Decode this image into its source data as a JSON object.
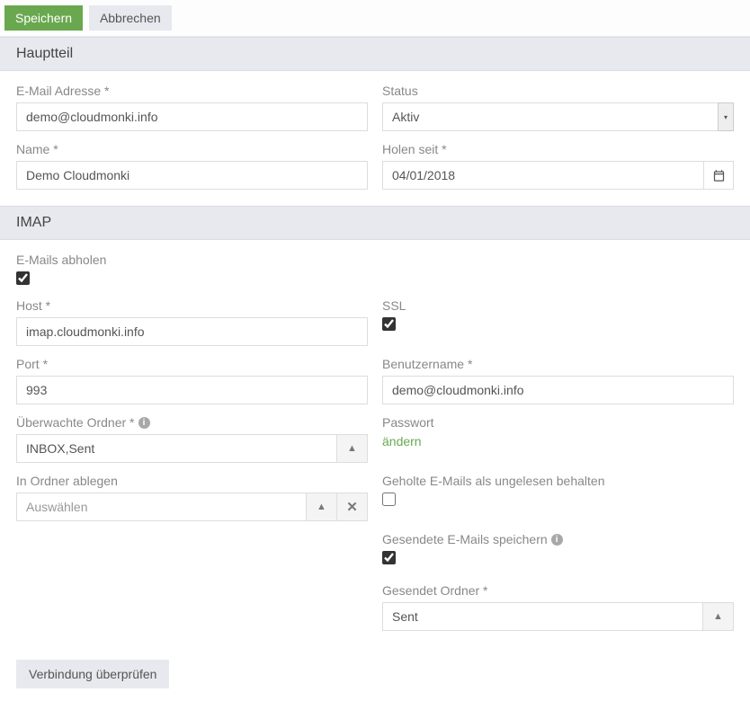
{
  "toolbar": {
    "save": "Speichern",
    "cancel": "Abbrechen"
  },
  "sections": {
    "main": {
      "title": "Hauptteil",
      "email_label": "E-Mail Adresse *",
      "email_value": "demo@cloudmonki.info",
      "status_label": "Status",
      "status_value": "Aktiv",
      "name_label": "Name *",
      "name_value": "Demo Cloudmonki",
      "fetch_since_label": "Holen seit *",
      "fetch_since_value": "04/01/2018"
    },
    "imap": {
      "title": "IMAP",
      "fetch_label": "E-Mails abholen",
      "fetch_checked": true,
      "host_label": "Host *",
      "host_value": "imap.cloudmonki.info",
      "ssl_label": "SSL",
      "ssl_checked": true,
      "port_label": "Port *",
      "port_value": "993",
      "username_label": "Benutzername *",
      "username_value": "demo@cloudmonki.info",
      "monitored_label": "Überwachte Ordner *",
      "monitored_value": "INBOX,Sent",
      "password_label": "Passwort",
      "password_action": "ändern",
      "put_folder_label": "In Ordner ablegen",
      "put_folder_placeholder": "Auswählen",
      "keep_unread_label": "Geholte E-Mails als ungelesen behalten",
      "keep_unread_checked": false,
      "store_sent_label": "Gesendete E-Mails speichern",
      "store_sent_checked": true,
      "sent_folder_label": "Gesendet Ordner *",
      "sent_folder_value": "Sent"
    }
  },
  "footer": {
    "check_connection": "Verbindung überprüfen"
  }
}
